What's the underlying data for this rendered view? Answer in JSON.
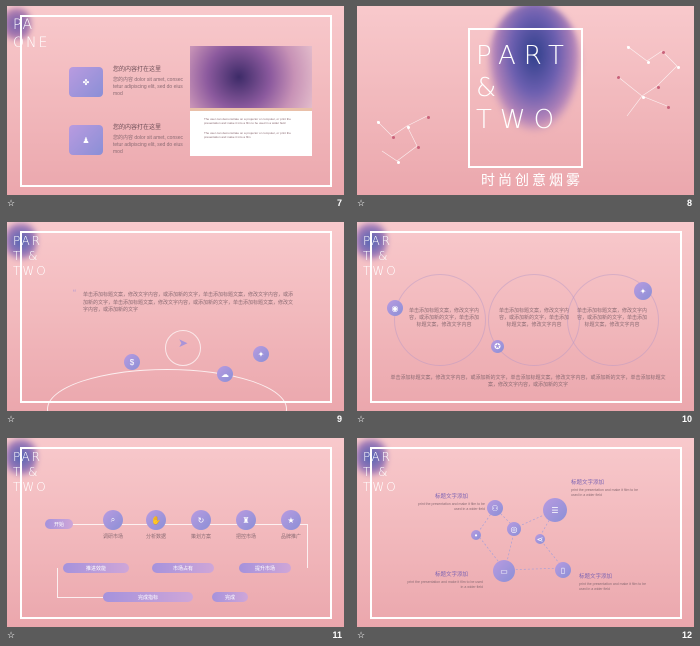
{
  "slides": [
    {
      "num": "7",
      "star": "☆",
      "title_lines": [
        "PA",
        "ONE"
      ],
      "item1": {
        "title": "您的内容打在这里",
        "body": "您的内容  dolor  sit  amet,  consec tetur adipiscing  elit,  sed do eius mod"
      },
      "item2": {
        "title": "您的内容打在这里",
        "body": "您的内容  dolor  sit  amet,  consec tetur adipiscing  elit,  sed do eius mod"
      },
      "card_text1": "The user can demonstrate on a projector or computer, or print the presentation and make it into a film to be used in a wider field",
      "card_text2": "The user can demonstrate on a projector or computer, or print the presentation and make it into a film"
    },
    {
      "num": "8",
      "star": "☆",
      "big": "PART & TWO",
      "subtitle": "时尚创意烟雾"
    },
    {
      "num": "9",
      "star": "☆",
      "title_lines": [
        "PAR",
        "T &",
        "TWO"
      ],
      "quote": "单击添加标题文案，修改文字内容，或添加新的文字，单击添加标题文案，修改文字内容，或添加新的文字，单击添加标题文案，修改文字内容，或添加新的文字，单击添加标题文案，修改文字内容，或添加新的文字"
    },
    {
      "num": "10",
      "star": "☆",
      "title_lines": [
        "PAR",
        "T &",
        "TWO"
      ],
      "col": "单击添加标题文案，修改文字内容，或添加新的文字，单击添加标题文案，修改文字内容",
      "bottom": "单击添加标题文案，修改文字内容，或添加新的文字，单击添加标题文案，修改文字内容，或添加新的文字，单击添加标题文案，修改文字内容，或添加新的文字"
    },
    {
      "num": "11",
      "star": "☆",
      "title_lines": [
        "PAR",
        "T &",
        "TWO"
      ],
      "start": "开始",
      "steps": [
        "调研市场",
        "分析数据",
        "策划方案",
        "把控市场",
        "品牌推广"
      ],
      "row2": [
        "推进效能",
        "市场占有",
        "提升市场"
      ],
      "row3": [
        "完成指标",
        "完成"
      ]
    },
    {
      "num": "12",
      "star": "☆",
      "title_lines": [
        "PAR",
        "T &",
        "TWO"
      ],
      "label": "标题文字添加",
      "desc": "print the presentation and make it film to be used in a wider field"
    }
  ]
}
